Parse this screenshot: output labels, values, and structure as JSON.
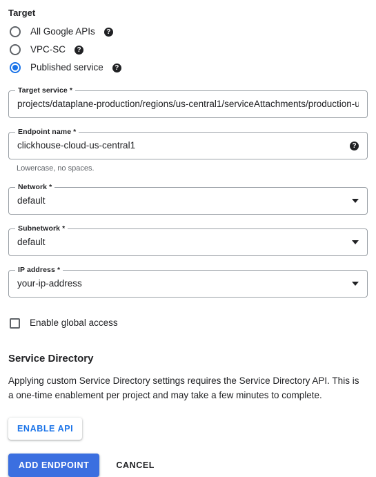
{
  "target_section": {
    "heading": "Target",
    "options": [
      {
        "label": "All Google APIs",
        "selected": false,
        "help_icon": "help-icon"
      },
      {
        "label": "VPC-SC",
        "selected": false,
        "help_icon": "help-icon"
      },
      {
        "label": "Published service",
        "selected": true,
        "help_icon": "help-icon"
      }
    ]
  },
  "fields": {
    "target_service": {
      "label": "Target service *",
      "value": "projects/dataplane-production/regions/us-central1/serviceAttachments/production-u"
    },
    "endpoint_name": {
      "label": "Endpoint name *",
      "value": "clickhouse-cloud-us-central1",
      "help_icon": "help-icon",
      "hint": "Lowercase, no spaces."
    },
    "network": {
      "label": "Network *",
      "value": "default",
      "caret_icon": "chevron-down-icon"
    },
    "subnetwork": {
      "label": "Subnetwork *",
      "value": "default",
      "caret_icon": "chevron-down-icon"
    },
    "ip_address": {
      "label": "IP address *",
      "value": "your-ip-address",
      "caret_icon": "chevron-down-icon"
    }
  },
  "global_access": {
    "label": "Enable global access",
    "checked": false
  },
  "service_directory": {
    "heading": "Service Directory",
    "body": "Applying custom Service Directory settings requires the Service Directory API. This is a one-time enablement per project and may take a few minutes to complete.",
    "enable_api_label": "ENABLE API"
  },
  "actions": {
    "primary_label": "ADD ENDPOINT",
    "cancel_label": "CANCEL"
  },
  "colors": {
    "accent_blue": "#1a73e8",
    "primary_button_blue": "#3b6fe0",
    "text_primary": "#202124",
    "text_secondary": "#5f6368",
    "border_gray": "#9aa0a6"
  },
  "help_glyph": "?"
}
